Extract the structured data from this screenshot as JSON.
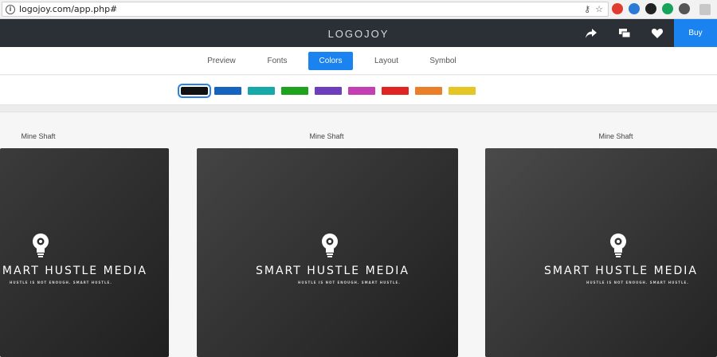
{
  "browser": {
    "url": "logojoy.com/app.php#",
    "info_glyph": "i",
    "key_glyph": "⚷",
    "star_glyph": "☆",
    "extensions": [
      {
        "name": "adobe-icon",
        "color": "#e03b2f"
      },
      {
        "name": "ring-icon",
        "color": "#2b7bd6"
      },
      {
        "name": "buffer-icon",
        "color": "#222222"
      },
      {
        "name": "grammarly-icon",
        "color": "#16a35a"
      },
      {
        "name": "pocket-icon",
        "color": "#555555"
      }
    ]
  },
  "header": {
    "title": "LOGOJOY",
    "buy_label": "Buy",
    "accent": "#1a83f0",
    "bg": "#2b2f36"
  },
  "tabs": [
    {
      "label": "Preview",
      "active": false
    },
    {
      "label": "Fonts",
      "active": false
    },
    {
      "label": "Colors",
      "active": true
    },
    {
      "label": "Layout",
      "active": false
    },
    {
      "label": "Symbol",
      "active": false
    }
  ],
  "swatches": [
    {
      "name": "black",
      "color": "#111111",
      "selected": true
    },
    {
      "name": "blue",
      "color": "#1565c0",
      "selected": false
    },
    {
      "name": "teal",
      "color": "#17a9a9",
      "selected": false
    },
    {
      "name": "green",
      "color": "#1fa31f",
      "selected": false
    },
    {
      "name": "purple",
      "color": "#6e3fbd",
      "selected": false
    },
    {
      "name": "magenta",
      "color": "#c43fb4",
      "selected": false
    },
    {
      "name": "red",
      "color": "#e02424",
      "selected": false
    },
    {
      "name": "orange",
      "color": "#ea7f2a",
      "selected": false
    },
    {
      "name": "yellow",
      "color": "#e6c625",
      "selected": false
    }
  ],
  "cards": [
    {
      "label": "Mine Shaft",
      "brand": "SMART HUSTLE MEDIA",
      "tagline": "HUSTLE IS NOT ENOUGH. SMART HUSTLE."
    },
    {
      "label": "Mine Shaft",
      "brand": "SMART HUSTLE MEDIA",
      "tagline": "HUSTLE IS NOT ENOUGH. SMART HUSTLE."
    },
    {
      "label": "Mine Shaft",
      "brand": "SMART HUSTLE MEDIA",
      "tagline": "HUSTLE IS NOT ENOUGH. SMART HUSTLE."
    }
  ]
}
